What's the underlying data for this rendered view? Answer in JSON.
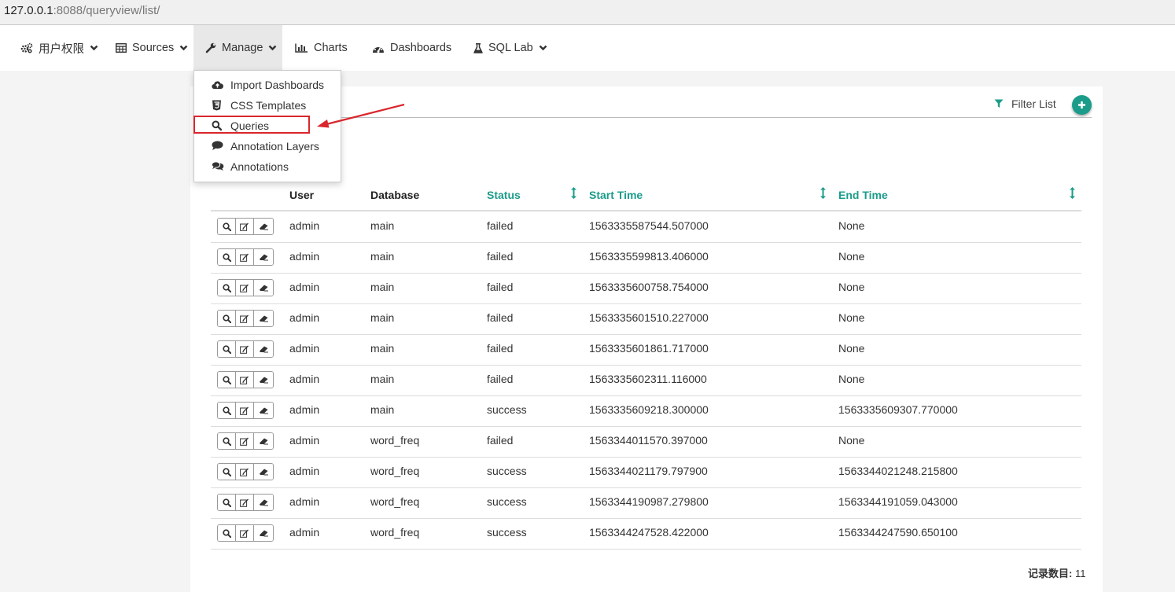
{
  "browser": {
    "url_host": "127.0.0.1",
    "url_path": ":8088/queryview/list/"
  },
  "navbar": {
    "items": [
      {
        "label": "用户权限",
        "icon": "cogs-icon",
        "has_caret": true
      },
      {
        "label": "Sources",
        "icon": "table-icon",
        "has_caret": true
      },
      {
        "label": "Manage",
        "icon": "wrench-icon",
        "has_caret": true,
        "active": true
      },
      {
        "label": "Charts",
        "icon": "bar-chart-icon",
        "has_caret": false
      },
      {
        "label": "Dashboards",
        "icon": "dashboard-icon",
        "has_caret": false
      },
      {
        "label": "SQL Lab",
        "icon": "flask-icon",
        "has_caret": true
      }
    ]
  },
  "manage_menu": {
    "items": [
      {
        "label": "Import Dashboards",
        "icon": "cloud-upload-icon"
      },
      {
        "label": "CSS Templates",
        "icon": "css3-icon"
      },
      {
        "label": "Queries",
        "icon": "search-icon",
        "highlighted": true
      },
      {
        "label": "Annotation Layers",
        "icon": "comment-icon"
      },
      {
        "label": "Annotations",
        "icon": "comments-icon"
      }
    ]
  },
  "toolbar": {
    "filter_label": "Filter List",
    "add_icon": "plus-icon"
  },
  "table": {
    "columns": [
      "User",
      "Database",
      "Status",
      "Start Time",
      "End Time"
    ],
    "sortable_columns": [
      "Status",
      "Start Time",
      "End Time"
    ],
    "row_actions": [
      "search-icon",
      "edit-icon",
      "eraser-icon"
    ],
    "rows": [
      [
        "admin",
        "main",
        "failed",
        "1563335587544.507000",
        "None"
      ],
      [
        "admin",
        "main",
        "failed",
        "1563335599813.406000",
        "None"
      ],
      [
        "admin",
        "main",
        "failed",
        "1563335600758.754000",
        "None"
      ],
      [
        "admin",
        "main",
        "failed",
        "1563335601510.227000",
        "None"
      ],
      [
        "admin",
        "main",
        "failed",
        "1563335601861.717000",
        "None"
      ],
      [
        "admin",
        "main",
        "failed",
        "1563335602311.116000",
        "None"
      ],
      [
        "admin",
        "main",
        "success",
        "1563335609218.300000",
        "1563335609307.770000"
      ],
      [
        "admin",
        "word_freq",
        "failed",
        "1563344011570.397000",
        "None"
      ],
      [
        "admin",
        "word_freq",
        "success",
        "1563344021179.797900",
        "1563344021248.215800"
      ],
      [
        "admin",
        "word_freq",
        "success",
        "1563344190987.279800",
        "1563344191059.043000"
      ],
      [
        "admin",
        "word_freq",
        "success",
        "1563344247528.422000",
        "1563344247590.650100"
      ]
    ]
  },
  "footer": {
    "record_label": "记录数目:",
    "record_count": "11"
  },
  "colors": {
    "accent": "#1b9c8a",
    "highlight_box": "#d9262c"
  }
}
